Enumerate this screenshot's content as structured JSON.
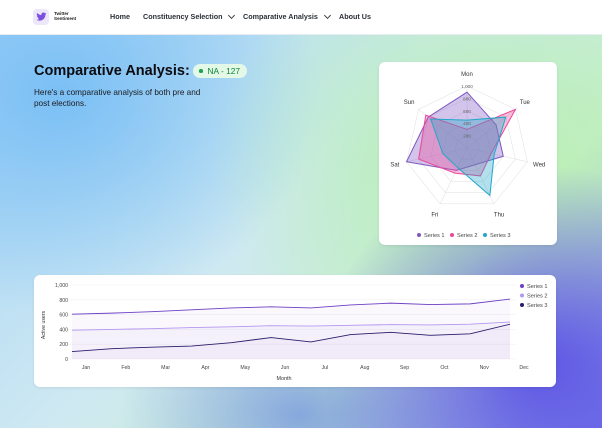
{
  "brand": {
    "line1": "Twitter",
    "line2": "Sentiment",
    "logo_icon": "bird-icon"
  },
  "nav": {
    "home": "Home",
    "constituency": "Constituency Selection",
    "comparative": "Comparative Analysis",
    "about": "About Us"
  },
  "hero": {
    "title": "Comparative Analysis:",
    "badge": "NA - 127",
    "subtitle": "Here's a comparative analysis of both pre and post elections."
  },
  "colors": {
    "series1": "#7e57c2",
    "series2": "#ec4899",
    "series3": "#22a7c9",
    "badge_green": "#18a44b"
  },
  "chart_data": [
    {
      "type": "radar",
      "axes": [
        "Mon",
        "Tue",
        "Wed",
        "Thu",
        "Fri",
        "Sat",
        "Sun"
      ],
      "ticks": [
        "200",
        "400",
        "600",
        "800",
        "1,000"
      ],
      "rmax": 1000,
      "series": [
        {
          "name": "Series 1",
          "values": [
            900,
            600,
            600,
            300,
            400,
            1000,
            800
          ]
        },
        {
          "name": "Series 2",
          "values": [
            300,
            1000,
            400,
            500,
            450,
            800,
            850
          ]
        },
        {
          "name": "Series 3",
          "values": [
            450,
            800,
            450,
            850,
            350,
            400,
            750
          ]
        }
      ],
      "legend": "bottom"
    },
    {
      "type": "line",
      "categories": [
        "Jan",
        "Feb",
        "Mar",
        "Apr",
        "May",
        "Jun",
        "Jul",
        "Aug",
        "Sep",
        "Oct",
        "Nov",
        "Dec"
      ],
      "ylim": [
        0,
        1000
      ],
      "yticks": [
        "0",
        "200",
        "400",
        "600",
        "800",
        "1,000"
      ],
      "xlabel": "Month",
      "ylabel": "Active users",
      "legend": "top-right",
      "series": [
        {
          "name": "Series 1",
          "values": [
            605,
            620,
            640,
            665,
            690,
            705,
            690,
            730,
            755,
            735,
            745,
            810
          ]
        },
        {
          "name": "Series 2",
          "values": [
            390,
            400,
            410,
            425,
            435,
            450,
            445,
            455,
            465,
            460,
            470,
            500
          ]
        },
        {
          "name": "Series 3",
          "values": [
            100,
            140,
            160,
            175,
            220,
            290,
            230,
            330,
            360,
            320,
            340,
            470
          ]
        }
      ]
    }
  ]
}
